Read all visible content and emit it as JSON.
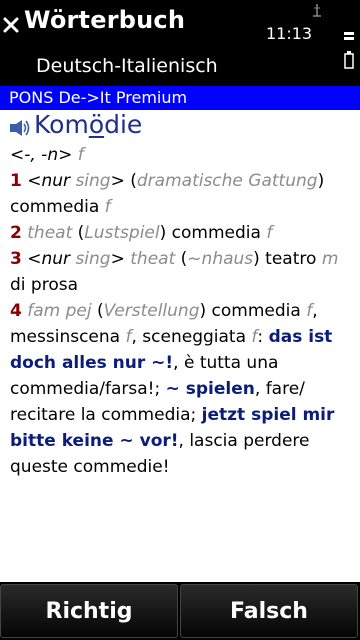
{
  "header": {
    "title": "Wörterbuch",
    "subtitle": "Deutsch-Italienisch",
    "time": "11:13"
  },
  "dictionary": {
    "name": "PONS De->It Premium"
  },
  "entry": {
    "headword_pre": "Kom",
    "headword_underlined": "ö",
    "headword_post": "die",
    "grammar": {
      "l1_a": "<-, -n>",
      "l1_b": "f"
    },
    "senses": {
      "s1": {
        "num": "1",
        "a": "<",
        "b": "nur",
        "c": "sing",
        "d": "> (",
        "e": "dramatische Gattung",
        "f": ")",
        "g": "commedia",
        "h": "f"
      },
      "s2": {
        "num": "2",
        "a": "theat",
        "b": "(",
        "c": "Lustspiel",
        "d": ") commedia",
        "e": "f"
      },
      "s3": {
        "num": "3",
        "a": "<",
        "b": "nur",
        "c": "sing",
        "d": ">",
        "e": "theat",
        "f": "(",
        "g": "~nhaus",
        "h": ") teatro",
        "i": "m",
        "j": "di prosa"
      },
      "s4": {
        "num": "4",
        "a": "fam pej",
        "b": "(",
        "c": "Verstellung",
        "d": ") commedia",
        "e": "f",
        "f": ", messinscena",
        "g": "f",
        "h": ", sceneggiata",
        "i": "f",
        "j": ":",
        "k": "das ist doch alles nur ~!",
        "l": ", è tutta una commedia/farsa!;",
        "m": "~ spielen",
        "n": ", fare/ recitare la commedia;",
        "o": "jetzt spiel mir bitte keine ~ vor!",
        "p": ", lascia perdere queste commedie!"
      }
    }
  },
  "footer": {
    "correct_label": "Richtig",
    "wrong_label": "Falsch"
  },
  "colors": {
    "header_bg": "#000000",
    "dictionary_bar": "#0000ff",
    "headword": "#1f2f8f",
    "sense_number": "#8b0000",
    "example_blue": "#0b1d7a",
    "gray_label": "#8c8c8c"
  }
}
